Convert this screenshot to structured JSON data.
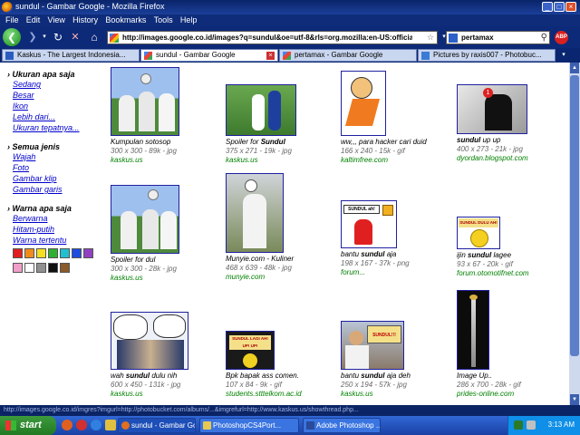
{
  "window": {
    "title": "sundul - Gambar Google - Mozilla Firefox",
    "controls": [
      "_",
      "□",
      "×"
    ]
  },
  "menu": [
    "File",
    "Edit",
    "View",
    "History",
    "Bookmarks",
    "Tools",
    "Help"
  ],
  "nav": {
    "url": "http://images.google.co.id/images?q=sundul&oe=utf-8&rls=org.mozilla:en-US:official&client",
    "search": "pertamax",
    "abp": "ABP"
  },
  "tabs": [
    {
      "label": "Kaskus - The Largest Indonesia...",
      "active": false
    },
    {
      "label": "sundul - Gambar Google",
      "active": true
    },
    {
      "label": "pertamax - Gambar Google",
      "active": false
    },
    {
      "label": "Pictures by raxis007 - Photobuc...",
      "active": false
    }
  ],
  "sidebar": {
    "size_heading": "Ukuran apa saja",
    "size_links": [
      "Sedang",
      "Besar",
      "Ikon",
      "Lebih dari...",
      "Ukuran tepatnya..."
    ],
    "type_heading": "Semua jenis",
    "type_links": [
      "Wajah",
      "Foto",
      "Gambar klip",
      "Gambar garis"
    ],
    "color_heading": "Warna apa saja",
    "color_links": [
      "Berwarna",
      "Hitam-putih",
      "Warna tertentu"
    ],
    "swatches": [
      "#e02020",
      "#f08c1c",
      "#f4e020",
      "#30b030",
      "#20c0d0",
      "#1c4ce0",
      "#9040c0",
      "#f0a0c8",
      "#ffffff",
      "#909090",
      "#101010",
      "#8a5a2a"
    ]
  },
  "results": [
    {
      "caption": "Kumpulan sotosop",
      "bold": "",
      "meta": "300 x 300 - 89k - jpg",
      "site": "kaskus.us"
    },
    {
      "caption": "Spoiler for ",
      "bold": "Sundul",
      "meta": "375 x 271 - 19k - jpg",
      "site": "kaskus.us"
    },
    {
      "caption": "ww,,, para hacker cari duid",
      "bold": "",
      "meta": "166 x 240 - 15k - gif",
      "site": "kaltimfree.com"
    },
    {
      "caption": "",
      "bold": "sundul",
      "caption_after": " up up",
      "meta": "400 x 273 - 21k - jpg",
      "site": "dyordan.blogspot.com"
    },
    {
      "caption": "Spoiler for dul",
      "bold": "",
      "meta": "300 x 300 - 28k - jpg",
      "site": "kaskus.us"
    },
    {
      "caption": "Munyie.com - Kuliner",
      "bold": "",
      "meta": "468 x 639 - 48k - jpg",
      "site": "munyie.com"
    },
    {
      "caption": "bantu ",
      "bold": "sundul",
      "caption_after": " aja",
      "meta": "198 x 167 - 37k - png",
      "site": "forum..."
    },
    {
      "caption": "ijin ",
      "bold": "sundul",
      "caption_after": " lagee",
      "meta": "93 x 67 - 20k - gif",
      "site": "forum.otomotifnet.com"
    },
    {
      "caption": "wah ",
      "bold": "sundul",
      "caption_after": " dulu nih",
      "meta": "600 x 450 - 131k - jpg",
      "site": "kaskus.us"
    },
    {
      "caption": "Bpk bapak ass comen.",
      "bold": "",
      "meta": "107 x 84 - 9k - gif",
      "site": "students.stttelkom.ac.id"
    },
    {
      "caption": "bantu ",
      "bold": "sundul",
      "caption_after": " aja deh",
      "meta": "250 x 194 - 57k - jpg",
      "site": "kaskus.us"
    },
    {
      "caption": "Image Up..",
      "bold": "",
      "meta": "286 x 700 - 28k - gif",
      "site": "prides-online.com"
    }
  ],
  "thumb_text": {
    "r7": "SUNDUL ah!",
    "r8": "SUNDUL DULU AH!",
    "r10": "SUNDUL LAGI AH! UP! UP!",
    "r11": "SUNDUL!!!"
  },
  "statusbar": "http://images.google.co.id/imgres?imgurl=http://photobucket.com/albums/...&imgrefurl=http://www.kaskus.us/showthread.php...",
  "taskbar": {
    "start": "start",
    "tasks": [
      {
        "label": "sundul - Gambar Go...",
        "active": true
      },
      {
        "label": "PhotoshopCS4Port...",
        "active": false
      },
      {
        "label": "Adobe Photoshop ...",
        "active": false
      }
    ],
    "clock": "3:13 AM"
  }
}
